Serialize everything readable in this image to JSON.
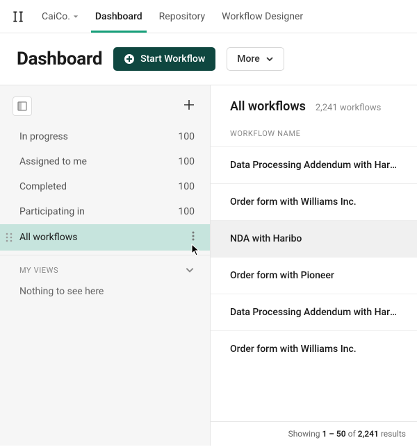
{
  "brand": "CaiCo.",
  "nav": {
    "tabs": [
      {
        "label": "Dashboard",
        "active": true
      },
      {
        "label": "Repository",
        "active": false
      },
      {
        "label": "Workflow Designer",
        "active": false
      }
    ]
  },
  "header": {
    "title": "Dashboard",
    "start_label": "Start Workflow",
    "more_label": "More"
  },
  "sidebar": {
    "filters": [
      {
        "label": "In progress",
        "count": "100",
        "active": false
      },
      {
        "label": "Assigned to me",
        "count": "100",
        "active": false
      },
      {
        "label": "Completed",
        "count": "100",
        "active": false
      },
      {
        "label": "Participating in",
        "count": "100",
        "active": false
      },
      {
        "label": "All workflows",
        "count": "",
        "active": true
      }
    ],
    "my_views_header": "MY VIEWS",
    "my_views_empty": "Nothing to see here"
  },
  "main": {
    "title": "All workflows",
    "subtitle": "2,241 workflows",
    "column_header": "WORKFLOW NAME",
    "rows": [
      {
        "name": "Data Processing Addendum with Haribo",
        "selected": false
      },
      {
        "name": "Order form with Williams Inc.",
        "selected": false
      },
      {
        "name": "NDA with Haribo",
        "selected": true
      },
      {
        "name": "Order form with Pioneer",
        "selected": false
      },
      {
        "name": "Data Processing Addendum with Haribo",
        "selected": false
      },
      {
        "name": "Order form with Williams Inc.",
        "selected": false
      }
    ],
    "footer": {
      "prefix": "Showing",
      "range": "1 – 50",
      "of": "of",
      "total": "2,241",
      "suffix": "results"
    }
  }
}
